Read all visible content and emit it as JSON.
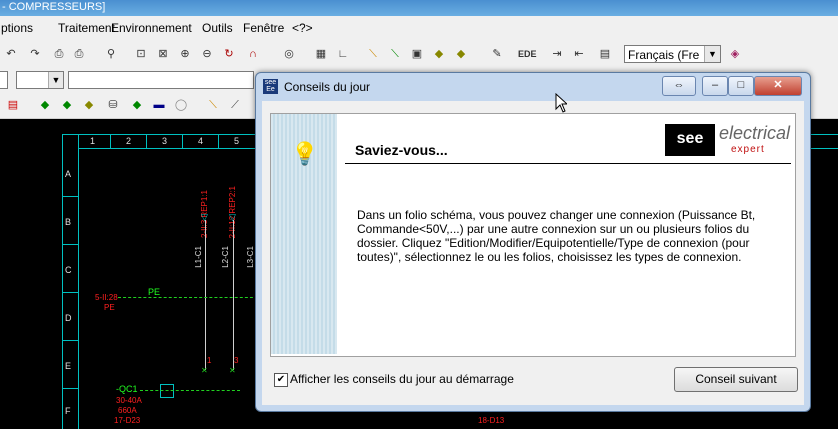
{
  "app": {
    "title": "- COMPRESSEURS]"
  },
  "menu": [
    "ptions",
    "Traitement",
    "Environnement",
    "Outils",
    "Fenêtre",
    "<?>"
  ],
  "toolbar": {
    "language": "Français (Fre"
  },
  "schematic": {
    "columns": [
      "1",
      "2",
      "3",
      "4",
      "5"
    ],
    "rows": [
      "A",
      "B",
      "C",
      "D",
      "E",
      "F"
    ],
    "wire_labels": [
      "2-II:3 REP1:1",
      "2-II:12 REP2:1",
      "L1-C1",
      "L2-C1",
      "L3-C1"
    ],
    "pe_label": "PE",
    "pe_ref": "5-II:28",
    "pe_ref2": "PE",
    "term1": "1",
    "term3": "3",
    "qc_label": "-QC1",
    "qc_spec1": "30-40A",
    "qc_spec2": "660A",
    "qc_spec3": "17-D23",
    "ref_bottom": "18-D13"
  },
  "dialog": {
    "title": "Conseils du jour",
    "heading": "Saviez-vous...",
    "logo_see": "see",
    "logo_electrical": "electrical",
    "logo_expert": "expert",
    "tip": "Dans un folio schéma, vous pouvez changer une connexion (Puissance Bt, Commande<50V,...) par une autre connexion sur un ou plusieurs folios du dossier. Cliquez \"Edition/Modifier/Equipotentielle/Type de connexion (pour toutes)\", sélectionnez le ou les folios, choisissez les types de connexion.",
    "checkbox_label": "Afficher les conseils du jour au démarrage",
    "checkbox_checked": true,
    "next_button": "Conseil suivant"
  }
}
